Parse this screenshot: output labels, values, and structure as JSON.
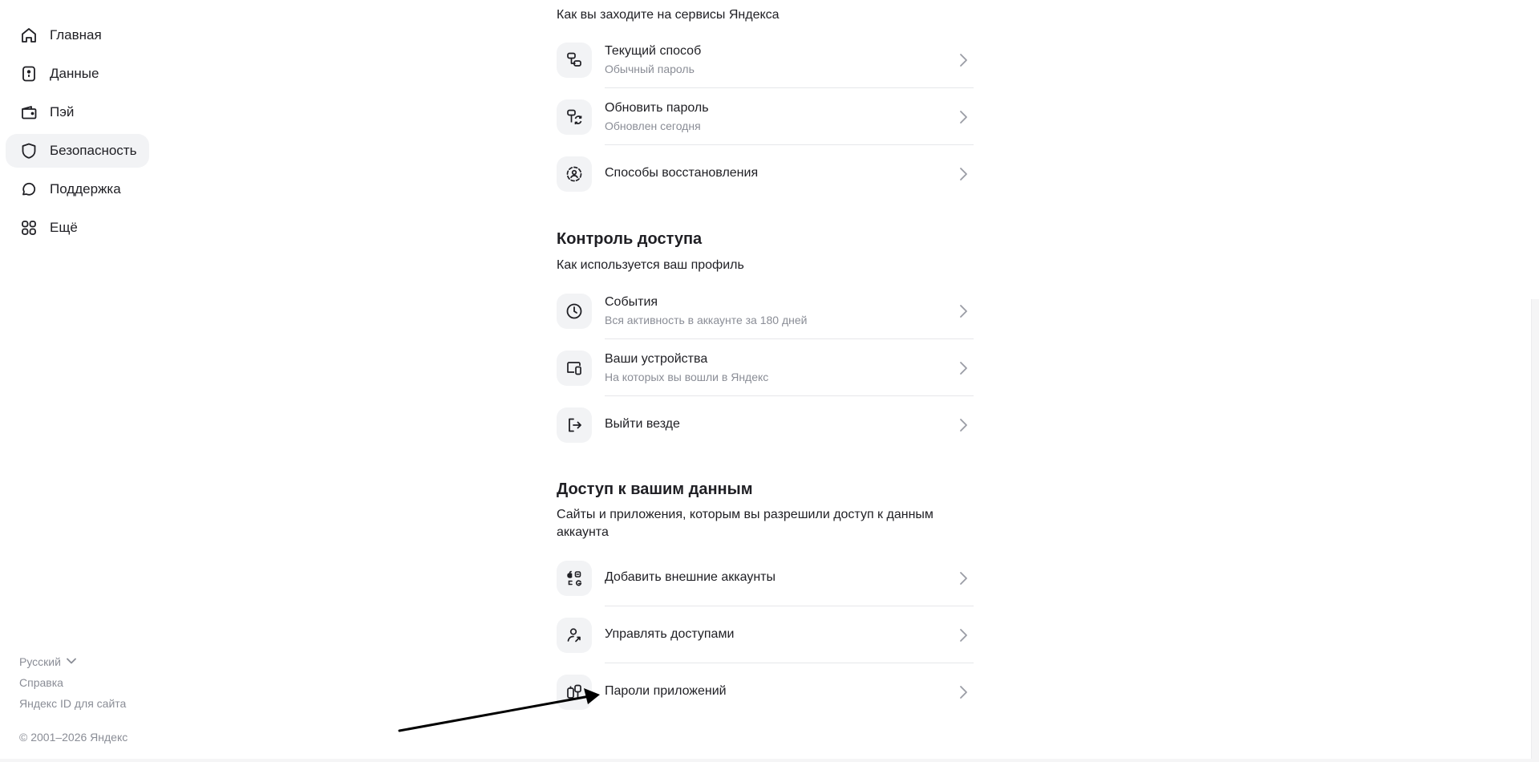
{
  "sidebar": {
    "items": [
      {
        "label": "Главная",
        "icon": "home-icon"
      },
      {
        "label": "Данные",
        "icon": "id-card-icon"
      },
      {
        "label": "Пэй",
        "icon": "wallet-icon"
      },
      {
        "label": "Безопасность",
        "icon": "shield-icon",
        "active": true
      },
      {
        "label": "Поддержка",
        "icon": "chat-icon"
      },
      {
        "label": "Ещё",
        "icon": "grid-icon"
      }
    ]
  },
  "footer": {
    "language": "Русский",
    "help": "Справка",
    "id_for_site": "Яндекс ID для сайта",
    "copyright": "© 2001–2026 Яндекс"
  },
  "main": {
    "login_section": {
      "subtitle": "Как вы заходите на сервисы Яндекса",
      "rows": [
        {
          "title": "Текущий способ",
          "subtitle": "Обычный пароль",
          "icon": "password-method-icon"
        },
        {
          "title": "Обновить пароль",
          "subtitle": "Обновлен сегодня",
          "icon": "password-refresh-icon"
        },
        {
          "title": "Способы восстановления",
          "icon": "recovery-icon"
        }
      ]
    },
    "access_control": {
      "title": "Контроль доступа",
      "subtitle": "Как используется ваш профиль",
      "rows": [
        {
          "title": "События",
          "subtitle": "Вся активность в аккаунте за 180 дней",
          "icon": "clock-icon"
        },
        {
          "title": "Ваши устройства",
          "subtitle": "На которых вы вошли в Яндекс",
          "icon": "devices-icon"
        },
        {
          "title": "Выйти везде",
          "icon": "logout-icon"
        }
      ]
    },
    "data_access": {
      "title": "Доступ к вашим данным",
      "subtitle": "Сайты и приложения, которым вы разрешили доступ к данным аккаунта",
      "rows": [
        {
          "title": "Добавить внешние аккаунты",
          "icon": "external-accounts-icon"
        },
        {
          "title": "Управлять доступами",
          "icon": "user-access-icon"
        },
        {
          "title": "Пароли приложений",
          "icon": "app-passwords-icon"
        }
      ]
    }
  },
  "colors": {
    "text": "#1f1f24",
    "secondary": "#8a8d96",
    "icon_bg": "#f2f3f5",
    "divider": "#e6e7ea"
  }
}
